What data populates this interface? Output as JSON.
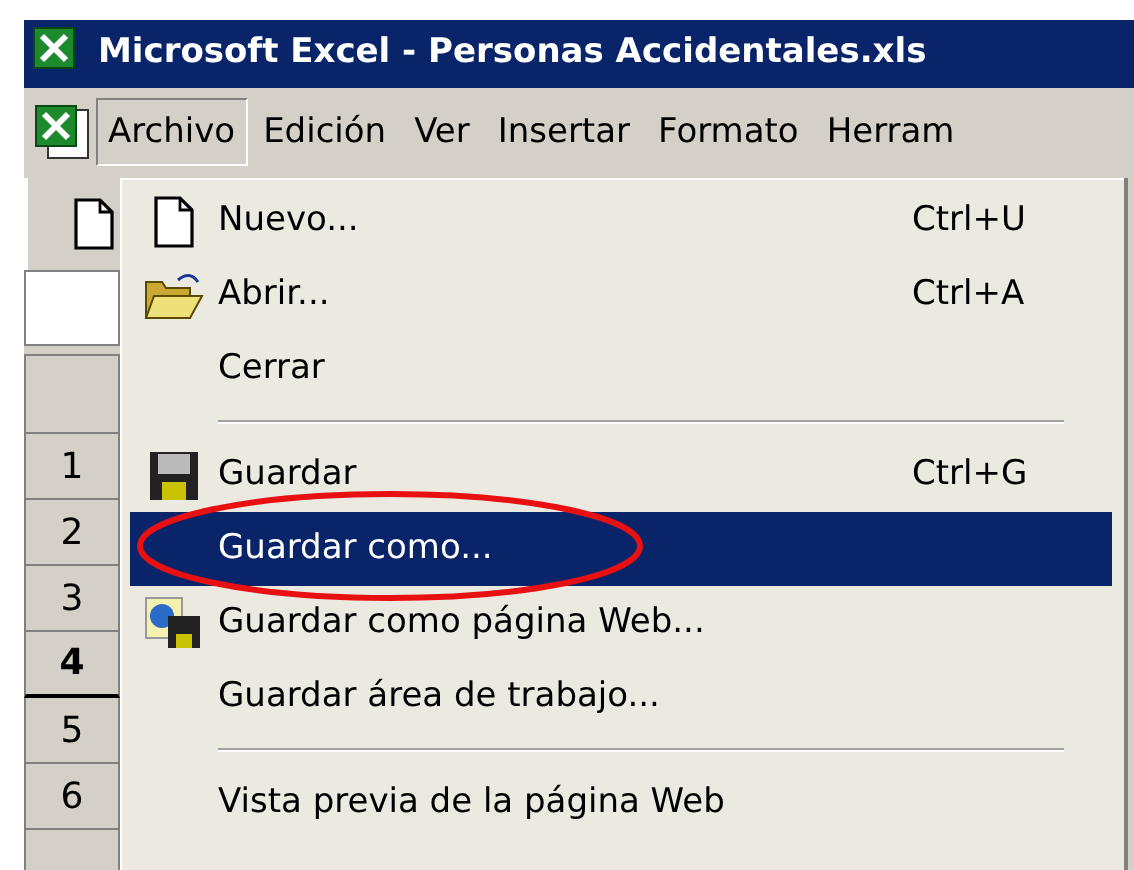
{
  "window": {
    "title": "Microsoft Excel - Personas Accidentales.xls"
  },
  "menu_bar": [
    {
      "label": "Archivo",
      "selected": true
    },
    {
      "label": "Edición",
      "selected": false
    },
    {
      "label": "Ver",
      "selected": false
    },
    {
      "label": "Insertar",
      "selected": false
    },
    {
      "label": "Formato",
      "selected": false
    },
    {
      "label": "Herram",
      "selected": false
    }
  ],
  "row_headers": [
    {
      "label": "1",
      "selected": false
    },
    {
      "label": "2",
      "selected": false
    },
    {
      "label": "3",
      "selected": false
    },
    {
      "label": "4",
      "selected": true
    },
    {
      "label": "5",
      "selected": false
    },
    {
      "label": "6",
      "selected": false
    }
  ],
  "menu": {
    "items": [
      {
        "kind": "item",
        "label": "Nuevo...",
        "shortcut": "Ctrl+U",
        "selected": false
      },
      {
        "kind": "item",
        "label": "Abrir...",
        "shortcut": "Ctrl+A",
        "selected": false
      },
      {
        "kind": "item",
        "label": "Cerrar",
        "selected": false
      },
      {
        "kind": "separator"
      },
      {
        "kind": "item",
        "label": "Guardar",
        "shortcut": "Ctrl+G",
        "selected": false
      },
      {
        "kind": "item",
        "label": "Guardar como...",
        "selected": true
      },
      {
        "kind": "item",
        "label": "Guardar como página Web...",
        "selected": false
      },
      {
        "kind": "item",
        "label": "Guardar área de trabajo...",
        "selected": false
      },
      {
        "kind": "separator"
      },
      {
        "kind": "item",
        "label": "Vista previa de la página Web",
        "selected": false
      }
    ]
  },
  "annotation": {
    "kind": "ellipse",
    "color": "#e81010"
  }
}
